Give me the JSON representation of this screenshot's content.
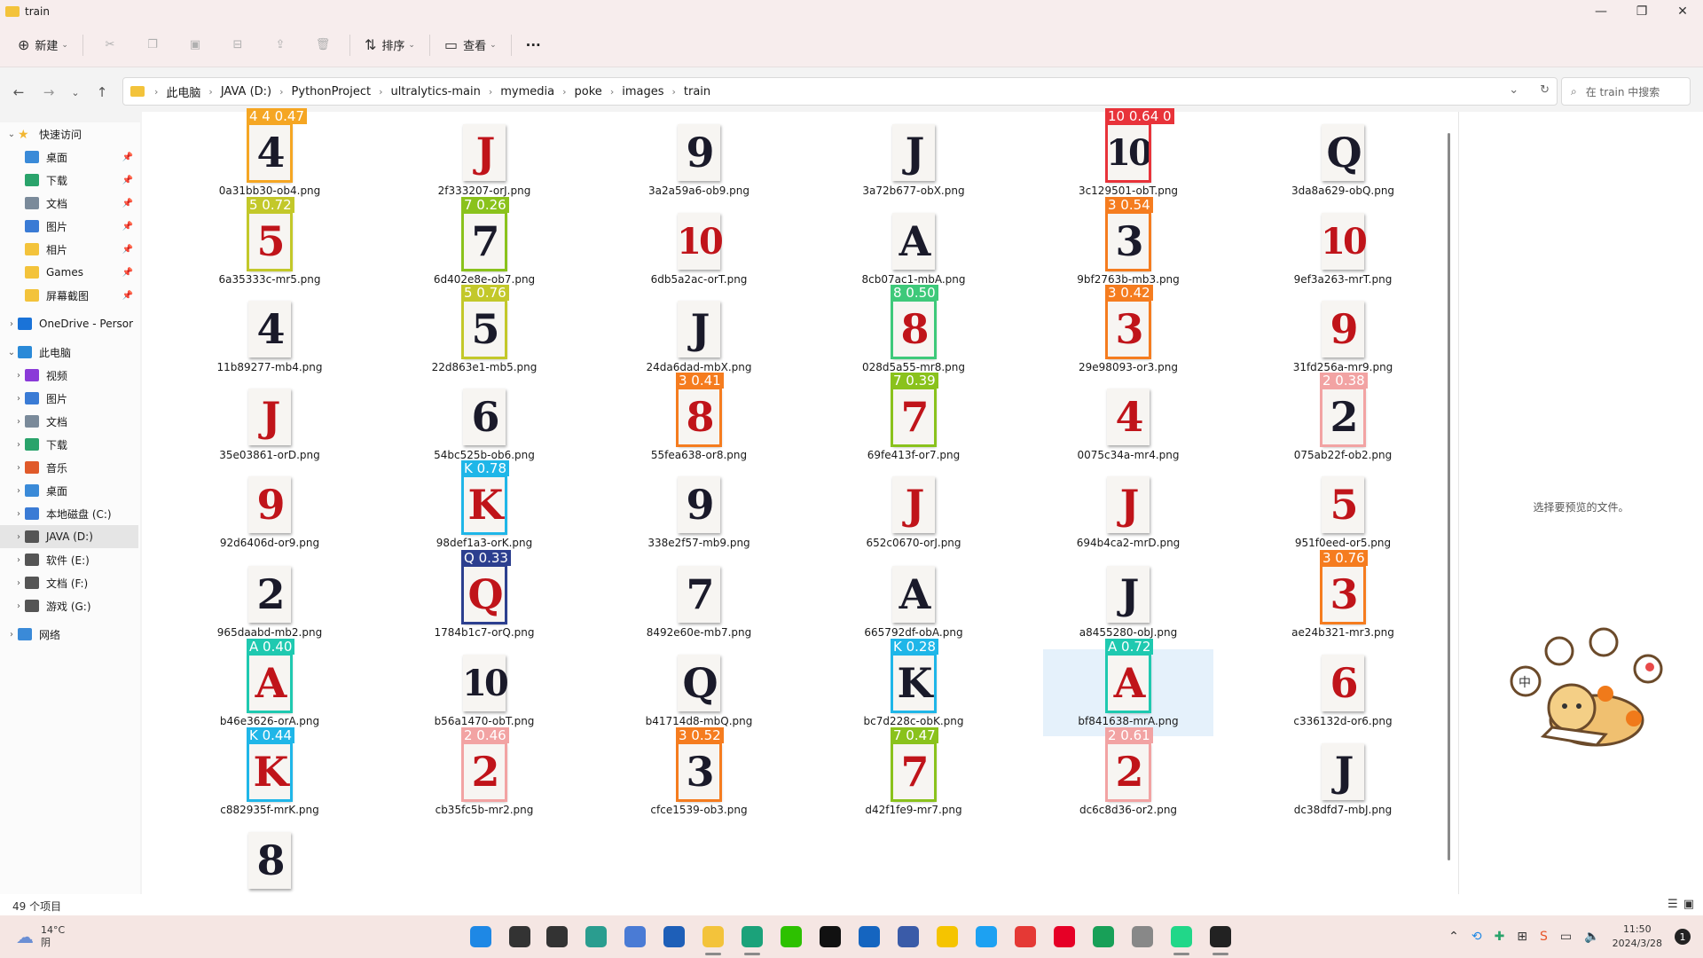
{
  "window": {
    "title": "train"
  },
  "window_controls": [
    "—",
    "❐",
    "✕"
  ],
  "commandbar": {
    "new_label": "新建",
    "sort_label": "排序",
    "view_label": "查看",
    "more_label": "···"
  },
  "nav": {
    "back": "←",
    "forward": "→",
    "recent": "⌄",
    "up": "↑"
  },
  "address": {
    "crumbs": [
      "此电脑",
      "JAVA (D:)",
      "PythonProject",
      "ultralytics-main",
      "mymedia",
      "poke",
      "images",
      "train"
    ]
  },
  "search": {
    "placeholder": "在 train 中搜索"
  },
  "sidebar": {
    "items": [
      {
        "label": "快速访问",
        "icon": "star-icon",
        "color": "#f2b632",
        "expand": "⌄",
        "pinned": false
      },
      {
        "label": "桌面",
        "icon": "desktop-icon",
        "color": "#3a8ad8",
        "expand": "",
        "pinned": true
      },
      {
        "label": "下载",
        "icon": "download-icon",
        "color": "#2aa36b",
        "expand": "",
        "pinned": true
      },
      {
        "label": "文档",
        "icon": "documents-icon",
        "color": "#7a8a9a",
        "expand": "",
        "pinned": true
      },
      {
        "label": "图片",
        "icon": "pictures-icon",
        "color": "#3a7bd5",
        "expand": "",
        "pinned": true
      },
      {
        "label": "相片",
        "icon": "folder-icon",
        "color": "#f3c33b",
        "expand": "",
        "pinned": true
      },
      {
        "label": "Games",
        "icon": "folder-icon",
        "color": "#f3c33b",
        "expand": "",
        "pinned": true
      },
      {
        "label": "屏幕截图",
        "icon": "folder-icon",
        "color": "#f3c33b",
        "expand": "",
        "pinned": true
      },
      {
        "label": "OneDrive - Persor",
        "icon": "onedrive-icon",
        "color": "#1a73d8",
        "expand": "›",
        "pinned": false
      },
      {
        "label": "此电脑",
        "icon": "pc-icon",
        "color": "#2a8ad8",
        "expand": "⌄",
        "pinned": false
      },
      {
        "label": "视频",
        "icon": "videos-icon",
        "color": "#8a3ad8",
        "expand": "›",
        "pinned": false
      },
      {
        "label": "图片",
        "icon": "pictures-icon",
        "color": "#3a7bd5",
        "expand": "›",
        "pinned": false
      },
      {
        "label": "文档",
        "icon": "documents-icon",
        "color": "#7a8a9a",
        "expand": "›",
        "pinned": false
      },
      {
        "label": "下载",
        "icon": "download-icon",
        "color": "#2aa36b",
        "expand": "›",
        "pinned": false
      },
      {
        "label": "音乐",
        "icon": "music-icon",
        "color": "#e05a2a",
        "expand": "›",
        "pinned": false
      },
      {
        "label": "桌面",
        "icon": "desktop-icon",
        "color": "#3a8ad8",
        "expand": "›",
        "pinned": false
      },
      {
        "label": "本地磁盘 (C:)",
        "icon": "windows-drive-icon",
        "color": "#3a7bd5",
        "expand": "›",
        "pinned": false
      },
      {
        "label": "JAVA (D:)",
        "icon": "drive-icon",
        "color": "#555555",
        "expand": "›",
        "pinned": false,
        "selected": true
      },
      {
        "label": "软件 (E:)",
        "icon": "drive-icon",
        "color": "#555555",
        "expand": "›",
        "pinned": false
      },
      {
        "label": "文档 (F:)",
        "icon": "drive-icon",
        "color": "#555555",
        "expand": "›",
        "pinned": false
      },
      {
        "label": "游戏 (G:)",
        "icon": "drive-icon",
        "color": "#555555",
        "expand": "›",
        "pinned": false
      },
      {
        "label": "网络",
        "icon": "network-icon",
        "color": "#3a8ad8",
        "expand": "›",
        "pinned": false
      }
    ]
  },
  "files": [
    {
      "name": "0a31bb30-ob4.png",
      "rank": "4",
      "color": "black",
      "det": {
        "label": "4 4 0.47",
        "color": "#f5a623"
      }
    },
    {
      "name": "2f333207-orJ.png",
      "rank": "J",
      "color": "red",
      "det": null
    },
    {
      "name": "3a2a59a6-ob9.png",
      "rank": "9",
      "color": "black",
      "det": null
    },
    {
      "name": "3a72b677-obX.png",
      "rank": "J",
      "color": "black",
      "det": null
    },
    {
      "name": "3c129501-obT.png",
      "rank": "10",
      "color": "black",
      "det": {
        "label": "10 0.64 0",
        "color": "#e8333a"
      }
    },
    {
      "name": "3da8a629-obQ.png",
      "rank": "Q",
      "color": "black",
      "det": null
    },
    {
      "name": "6a35333c-mr5.png",
      "rank": "5",
      "color": "red",
      "det": {
        "label": "5 0.72",
        "color": "#c3c82a"
      }
    },
    {
      "name": "6d402e8e-ob7.png",
      "rank": "7",
      "color": "black",
      "det": {
        "label": "7 0.26",
        "color": "#8ac21c"
      }
    },
    {
      "name": "6db5a2ac-orT.png",
      "rank": "10",
      "color": "red",
      "det": null
    },
    {
      "name": "8cb07ac1-mbA.png",
      "rank": "A",
      "color": "black",
      "det": null
    },
    {
      "name": "9bf2763b-mb3.png",
      "rank": "3",
      "color": "black",
      "det": {
        "label": "3 0.54",
        "color": "#f57c1f"
      }
    },
    {
      "name": "9ef3a263-mrT.png",
      "rank": "10",
      "color": "red",
      "det": null
    },
    {
      "name": "11b89277-mb4.png",
      "rank": "4",
      "color": "black",
      "det": null
    },
    {
      "name": "22d863e1-mb5.png",
      "rank": "5",
      "color": "black",
      "det": {
        "label": "5 0.76",
        "color": "#c3c82a"
      }
    },
    {
      "name": "24da6dad-mbX.png",
      "rank": "J",
      "color": "black",
      "det": null
    },
    {
      "name": "028d5a55-mr8.png",
      "rank": "8",
      "color": "red",
      "det": {
        "label": "8 0.50",
        "color": "#3ec97a"
      }
    },
    {
      "name": "29e98093-or3.png",
      "rank": "3",
      "color": "red",
      "det": {
        "label": "3 0.42",
        "color": "#f57c1f"
      }
    },
    {
      "name": "31fd256a-mr9.png",
      "rank": "9",
      "color": "red",
      "det": null
    },
    {
      "name": "35e03861-orD.png",
      "rank": "J",
      "color": "red",
      "det": null
    },
    {
      "name": "54bc525b-ob6.png",
      "rank": "6",
      "color": "black",
      "det": null
    },
    {
      "name": "55fea638-or8.png",
      "rank": "8",
      "color": "red",
      "det": {
        "label": "3 0.41",
        "color": "#f57c1f"
      }
    },
    {
      "name": "69fe413f-or7.png",
      "rank": "7",
      "color": "red",
      "det": {
        "label": "7 0.39",
        "color": "#8ac21c"
      }
    },
    {
      "name": "0075c34a-mr4.png",
      "rank": "4",
      "color": "red",
      "det": null
    },
    {
      "name": "075ab22f-ob2.png",
      "rank": "2",
      "color": "black",
      "det": {
        "label": "2 0.38",
        "color": "#f2a3a3"
      }
    },
    {
      "name": "92d6406d-or9.png",
      "rank": "9",
      "color": "red",
      "det": null
    },
    {
      "name": "98def1a3-orK.png",
      "rank": "K",
      "color": "red",
      "det": {
        "label": "K 0.78",
        "color": "#1fb6e8"
      }
    },
    {
      "name": "338e2f57-mb9.png",
      "rank": "9",
      "color": "black",
      "det": null
    },
    {
      "name": "652c0670-orJ.png",
      "rank": "J",
      "color": "red",
      "det": null
    },
    {
      "name": "694b4ca2-mrD.png",
      "rank": "J",
      "color": "red",
      "det": null
    },
    {
      "name": "951f0eed-or5.png",
      "rank": "5",
      "color": "red",
      "det": null
    },
    {
      "name": "965daabd-mb2.png",
      "rank": "2",
      "color": "black",
      "det": null
    },
    {
      "name": "1784b1c7-orQ.png",
      "rank": "Q",
      "color": "red",
      "det": {
        "label": "Q 0.33",
        "color": "#2c3f8f"
      }
    },
    {
      "name": "8492e60e-mb7.png",
      "rank": "7",
      "color": "black",
      "det": null
    },
    {
      "name": "665792df-obA.png",
      "rank": "A",
      "color": "black",
      "det": null
    },
    {
      "name": "a8455280-obJ.png",
      "rank": "J",
      "color": "black",
      "det": null
    },
    {
      "name": "ae24b321-mr3.png",
      "rank": "3",
      "color": "red",
      "det": {
        "label": "3 0.76",
        "color": "#f57c1f"
      }
    },
    {
      "name": "b46e3626-orA.png",
      "rank": "A",
      "color": "red",
      "det": {
        "label": "A 0.40",
        "color": "#1fc9b0"
      }
    },
    {
      "name": "b56a1470-obT.png",
      "rank": "10",
      "color": "black",
      "det": null
    },
    {
      "name": "b41714d8-mbQ.png",
      "rank": "Q",
      "color": "black",
      "det": null
    },
    {
      "name": "bc7d228c-obK.png",
      "rank": "K",
      "color": "black",
      "det": {
        "label": "K 0.28",
        "color": "#1fb6e8"
      }
    },
    {
      "name": "bf841638-mrA.png",
      "rank": "A",
      "color": "red",
      "det": {
        "label": "A 0.72",
        "color": "#1fc9b0"
      },
      "selected": true
    },
    {
      "name": "c336132d-or6.png",
      "rank": "6",
      "color": "red",
      "det": null
    },
    {
      "name": "c882935f-mrK.png",
      "rank": "K",
      "color": "red",
      "det": {
        "label": "K 0.44",
        "color": "#1fb6e8"
      }
    },
    {
      "name": "cb35fc5b-mr2.png",
      "rank": "2",
      "color": "red",
      "det": {
        "label": "2 0.46",
        "color": "#f2a3a3"
      }
    },
    {
      "name": "cfce1539-ob3.png",
      "rank": "3",
      "color": "black",
      "det": {
        "label": "3 0.52",
        "color": "#f57c1f"
      }
    },
    {
      "name": "d42f1fe9-mr7.png",
      "rank": "7",
      "color": "red",
      "det": {
        "label": "7 0.47",
        "color": "#8ac21c"
      }
    },
    {
      "name": "dc6c8d36-or2.png",
      "rank": "2",
      "color": "red",
      "det": {
        "label": "2 0.61",
        "color": "#f2a3a3"
      }
    },
    {
      "name": "dc38dfd7-mbJ.png",
      "rank": "J",
      "color": "black",
      "det": null
    },
    {
      "name": "",
      "rank": "8",
      "color": "black",
      "det": null
    }
  ],
  "preview": {
    "message": "选择要预览的文件。"
  },
  "status": {
    "count": "49 个项目"
  },
  "taskbar": {
    "weather_temp": "14°C",
    "weather_desc": "阴",
    "time": "11:50",
    "date": "2024/3/28",
    "notifications": "1",
    "apps": [
      {
        "icon": "windows-start-icon",
        "color": "#1e88e5"
      },
      {
        "icon": "search-icon",
        "color": "#333333"
      },
      {
        "icon": "task-view-icon",
        "color": "#333333"
      },
      {
        "icon": "chatgpt-icon",
        "color": "#2a9d8f"
      },
      {
        "icon": "photos-icon",
        "color": "#4a7bd5"
      },
      {
        "icon": "search-app-icon",
        "color": "#1e5fb8"
      },
      {
        "icon": "file-explorer-icon",
        "color": "#f3c33b",
        "active": true
      },
      {
        "icon": "edge-icon",
        "color": "#1ba27a",
        "active": true
      },
      {
        "icon": "wechat-icon",
        "color": "#2dc100"
      },
      {
        "icon": "notion-icon",
        "color": "#111111"
      },
      {
        "icon": "outlook-icon",
        "color": "#1565c0"
      },
      {
        "icon": "terminal-app-icon",
        "color": "#3a5ba8"
      },
      {
        "icon": "sticky-notes-icon",
        "color": "#f5c400"
      },
      {
        "icon": "twitter-icon",
        "color": "#1da1f2"
      },
      {
        "icon": "gmail-icon",
        "color": "#e53935"
      },
      {
        "icon": "netease-music-icon",
        "color": "#e60026"
      },
      {
        "icon": "terminal-icon",
        "color": "#18a058"
      },
      {
        "icon": "apple-icon",
        "color": "#888888"
      },
      {
        "icon": "pycharm-icon",
        "color": "#21d789",
        "active": true
      },
      {
        "icon": "console-icon",
        "color": "#222222",
        "active": true
      }
    ]
  }
}
